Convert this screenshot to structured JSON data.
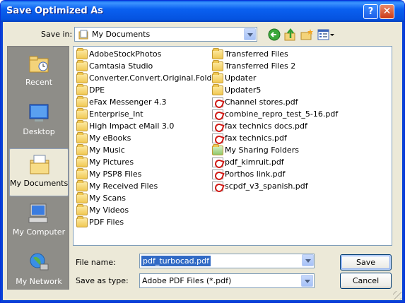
{
  "window": {
    "title": "Save Optimized As",
    "help_glyph": "?",
    "close_glyph": "✕"
  },
  "save_in": {
    "label": "Save in:",
    "value": "My Documents"
  },
  "toolbar": {
    "icons": [
      "back-icon",
      "up-folder-icon",
      "new-folder-icon",
      "views-menu-icon"
    ]
  },
  "places": [
    {
      "label": "Recent",
      "icon": "recent-icon"
    },
    {
      "label": "Desktop",
      "icon": "desktop-icon"
    },
    {
      "label": "My Documents",
      "icon": "my-documents-icon",
      "selected": true
    },
    {
      "label": "My Computer",
      "icon": "my-computer-icon"
    },
    {
      "label": "My Network",
      "icon": "my-network-icon"
    }
  ],
  "files_col1": [
    {
      "name": "AdobeStockPhotos",
      "type": "folder"
    },
    {
      "name": "Camtasia Studio",
      "type": "folder"
    },
    {
      "name": "Converter.Convert.Original.Folder",
      "type": "folder"
    },
    {
      "name": "DPE",
      "type": "folder"
    },
    {
      "name": "eFax Messenger 4.3",
      "type": "folder"
    },
    {
      "name": "Enterprise_Int",
      "type": "folder"
    },
    {
      "name": "High Impact eMail 3.0",
      "type": "folder"
    },
    {
      "name": "My eBooks",
      "type": "folder"
    },
    {
      "name": "My Music",
      "type": "folder"
    },
    {
      "name": "My Pictures",
      "type": "folder"
    },
    {
      "name": "My PSP8 Files",
      "type": "folder"
    },
    {
      "name": "My Received Files",
      "type": "folder"
    },
    {
      "name": "My Scans",
      "type": "folder"
    },
    {
      "name": "My Videos",
      "type": "folder"
    },
    {
      "name": "PDF Files",
      "type": "folder"
    }
  ],
  "files_col2": [
    {
      "name": "Transferred Files",
      "type": "folder"
    },
    {
      "name": "Transferred Files 2",
      "type": "folder"
    },
    {
      "name": "Updater",
      "type": "folder"
    },
    {
      "name": "Updater5",
      "type": "folder"
    },
    {
      "name": "Channel stores.pdf",
      "type": "pdf"
    },
    {
      "name": "combine_repro_test_5-16.pdf",
      "type": "pdf"
    },
    {
      "name": "fax technics docs.pdf",
      "type": "pdf"
    },
    {
      "name": "fax technics.pdf",
      "type": "pdf"
    },
    {
      "name": "My Sharing Folders",
      "type": "shared-folder"
    },
    {
      "name": "pdf_kimruit.pdf",
      "type": "pdf"
    },
    {
      "name": "Porthos link.pdf",
      "type": "pdf"
    },
    {
      "name": "scpdf_v3_spanish.pdf",
      "type": "pdf"
    }
  ],
  "file_name": {
    "label": "File name:",
    "value": "pdf_turbocad.pdf"
  },
  "save_as_type": {
    "label": "Save as type:",
    "value": "Adobe PDF Files (*.pdf)"
  },
  "buttons": {
    "save": "Save",
    "cancel": "Cancel"
  }
}
